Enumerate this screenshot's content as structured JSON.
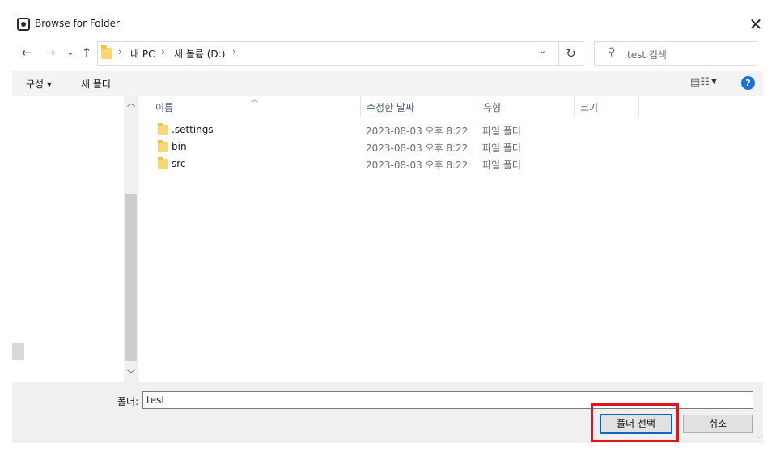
{
  "window": {
    "title": "Browse for Folder",
    "close_glyph": "✕"
  },
  "nav": {
    "back_glyph": "←",
    "forward_glyph": "→",
    "recent_glyph": "⌄",
    "up_glyph": "↑",
    "breadcrumb": [
      "내 PC",
      "새 볼륨 (D:)"
    ],
    "separator": "›",
    "dropdown_glyph": "⌄",
    "refresh_glyph": "↻",
    "search_placeholder": "test 검색"
  },
  "toolbar": {
    "organize_label": "구성 ▾",
    "new_folder_label": "새 폴더",
    "view_glyph": "▤☷",
    "view_caret": "▼",
    "help_glyph": "?"
  },
  "sidebar": {
    "scroll_up_glyph": "︿",
    "scroll_down_glyph": "﹀"
  },
  "filelist": {
    "sort_caret": "︿",
    "columns": [
      "이름",
      "수정한 날짜",
      "유형",
      "크기"
    ],
    "rows": [
      {
        "name": ".settings",
        "modified": "2023-08-03 오후 8:22",
        "type": "파일 폴더"
      },
      {
        "name": "bin",
        "modified": "2023-08-03 오후 8:22",
        "type": "파일 폴더"
      },
      {
        "name": "src",
        "modified": "2023-08-03 오후 8:22",
        "type": "파일 폴더"
      }
    ]
  },
  "footer": {
    "folder_label": "폴더:",
    "folder_value": "test",
    "select_button": "폴더 선택",
    "cancel_button": "취소"
  },
  "colors": {
    "highlight": "#e0131f",
    "accent": "#0a64c8",
    "folder": "#f8d775"
  },
  "icons": [
    "app-icon",
    "close-icon",
    "back-arrow-icon",
    "forward-arrow-icon",
    "up-arrow-icon",
    "folder-icon",
    "refresh-icon",
    "search-icon",
    "view-options-icon",
    "help-icon"
  ]
}
